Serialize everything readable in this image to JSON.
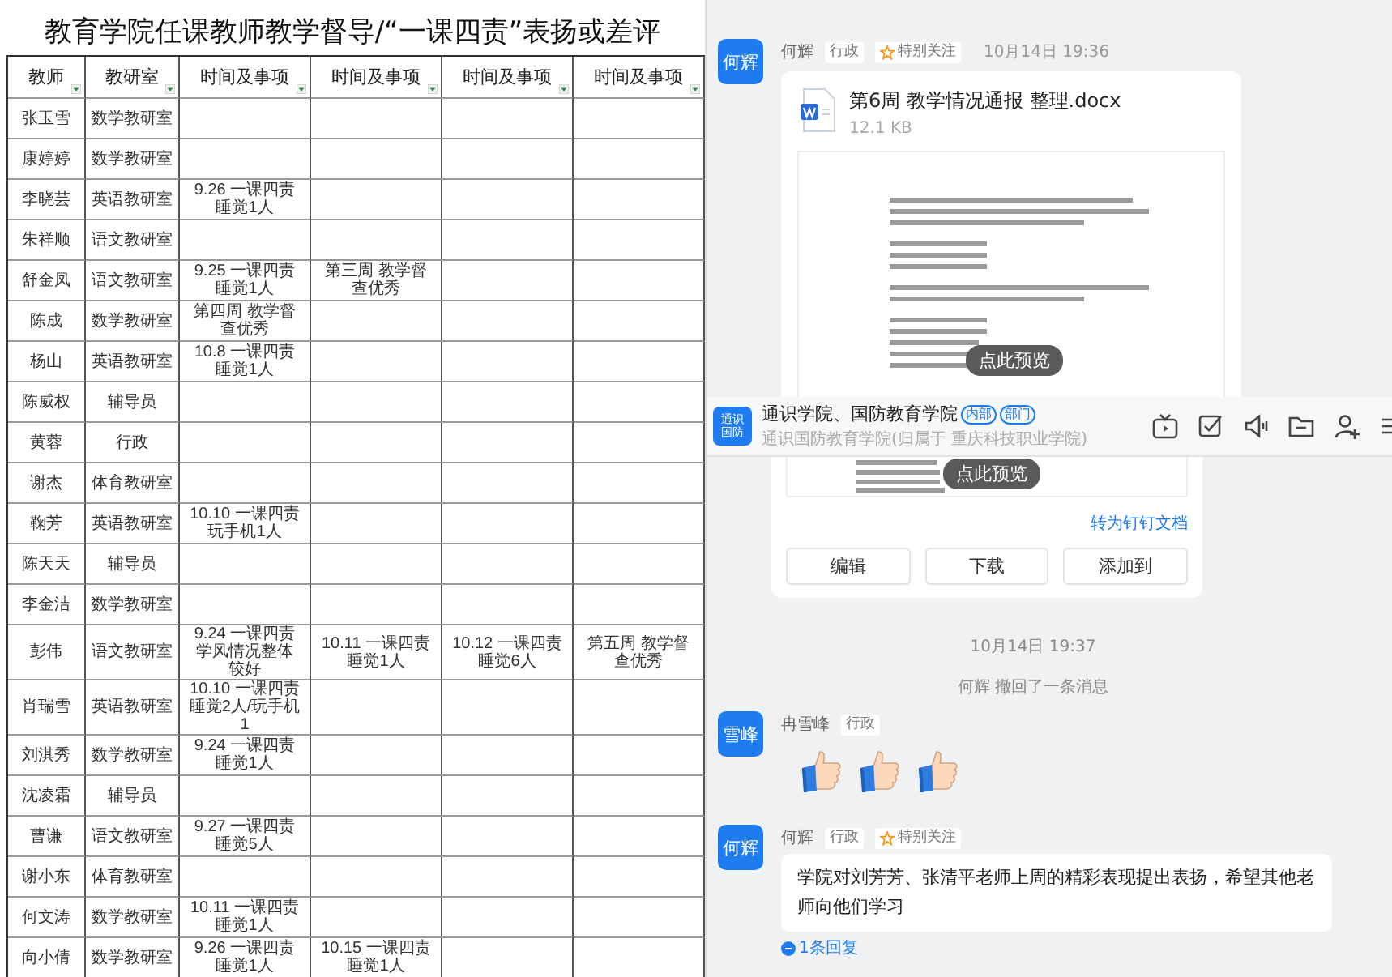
{
  "spreadsheet": {
    "title": "教育学院任课教师教学督导/“一课四责”表扬或差评",
    "columns": [
      "教师",
      "教研室",
      "时间及事项",
      "时间及事项",
      "时间及事项",
      "时间及事项"
    ],
    "rows": [
      {
        "cells": [
          "张玉雪",
          "数学教研室",
          "",
          "",
          "",
          ""
        ]
      },
      {
        "cells": [
          "康婷婷",
          "数学教研室",
          "",
          "",
          "",
          ""
        ]
      },
      {
        "cells": [
          "李晓芸",
          "英语教研室",
          "9.26 一课四责睡觉1人",
          "",
          "",
          ""
        ]
      },
      {
        "cells": [
          "朱祥顺",
          "语文教研室",
          "",
          "",
          "",
          ""
        ]
      },
      {
        "cells": [
          "舒金凤",
          "语文教研室",
          "9.25 一课四责睡觉1人",
          "第三周 教学督查优秀",
          "",
          ""
        ]
      },
      {
        "cells": [
          "陈成",
          "数学教研室",
          "第四周 教学督查优秀",
          "",
          "",
          ""
        ]
      },
      {
        "cells": [
          "杨山",
          "英语教研室",
          "10.8 一课四责睡觉1人",
          "",
          "",
          ""
        ]
      },
      {
        "cells": [
          "陈威权",
          "辅导员",
          "",
          "",
          "",
          ""
        ]
      },
      {
        "cells": [
          "黄蓉",
          "行政",
          "",
          "",
          "",
          ""
        ]
      },
      {
        "cells": [
          "谢杰",
          "体育教研室",
          "",
          "",
          "",
          ""
        ]
      },
      {
        "cells": [
          "鞠芳",
          "英语教研室",
          "10.10 一课四责玩手机1人",
          "",
          "",
          ""
        ]
      },
      {
        "cells": [
          "陈天天",
          "辅导员",
          "",
          "",
          "",
          ""
        ]
      },
      {
        "cells": [
          "李金洁",
          "数学教研室",
          "",
          "",
          "",
          ""
        ]
      },
      {
        "cells": [
          "彭伟",
          "语文教研室",
          "9.24 一课四责学风情况整体较好",
          "10.11 一课四责睡觉1人",
          "10.12 一课四责睡觉6人",
          "第五周 教学督查优秀"
        ]
      },
      {
        "cells": [
          "肖瑞雪",
          "英语教研室",
          "10.10 一课四责睡觉2人/玩手机1",
          "",
          "",
          ""
        ]
      },
      {
        "cells": [
          "刘淇秀",
          "数学教研室",
          "9.24 一课四责睡觉1人",
          "",
          "",
          ""
        ]
      },
      {
        "cells": [
          "沈凌霜",
          "辅导员",
          "",
          "",
          "",
          ""
        ]
      },
      {
        "cells": [
          "曹谦",
          "语文教研室",
          "9.27 一课四责睡觉5人",
          "",
          "",
          ""
        ]
      },
      {
        "cells": [
          "谢小东",
          "体育教研室",
          "",
          "",
          "",
          ""
        ]
      },
      {
        "cells": [
          "何文涛",
          "数学教研室",
          "10.11 一课四责睡觉1人",
          "",
          "",
          ""
        ]
      },
      {
        "cells": [
          "向小倩",
          "数学教研室",
          "9.26 一课四责睡觉1人",
          "10.15 一课四责睡觉1人",
          "",
          ""
        ]
      }
    ]
  },
  "chat": {
    "file_message": {
      "avatar": "何辉",
      "sender": "何辉",
      "tags": [
        {
          "kind": "role",
          "text": "行政"
        },
        {
          "kind": "follow",
          "text": "特别关注"
        }
      ],
      "time": "10月14日 19:36",
      "file": {
        "name": "第6周 教学情况通报 整理.docx",
        "size": "12.1 KB",
        "preview_button": "点此预览"
      }
    },
    "group_header": {
      "avatar_lines": [
        "通识",
        "国防"
      ],
      "title": "通识学院、国防教育学院",
      "badges": [
        "内部",
        "部门"
      ],
      "subtitle": "通识国防教育学院(归属于 重庆科技职业学院)"
    },
    "file_card_tail": {
      "preview_button": "点此预览",
      "link": "转为钉钉文档",
      "buttons": [
        "编辑",
        "下载",
        "添加到"
      ]
    },
    "time_divider": "10月14日 19:37",
    "system_notice": "何辉 撤回了一条消息",
    "messages": [
      {
        "kind": "stickers",
        "avatar": "雪峰",
        "sender": "冉雪峰",
        "tags": [
          {
            "kind": "role",
            "text": "行政"
          }
        ],
        "stickers": [
          {
            "kind": "thumbs_up"
          },
          {
            "kind": "thumbs_up"
          },
          {
            "kind": "thumbs_up"
          }
        ]
      },
      {
        "kind": "text",
        "avatar": "何辉",
        "sender": "何辉",
        "tags": [
          {
            "kind": "role",
            "text": "行政"
          },
          {
            "kind": "follow",
            "text": "特别关注"
          }
        ],
        "text": "学院对刘芳芳、张清平老师上周的精彩表现提出表扬，希望其他老师向他们学习",
        "replies": "1条回复"
      }
    ]
  }
}
